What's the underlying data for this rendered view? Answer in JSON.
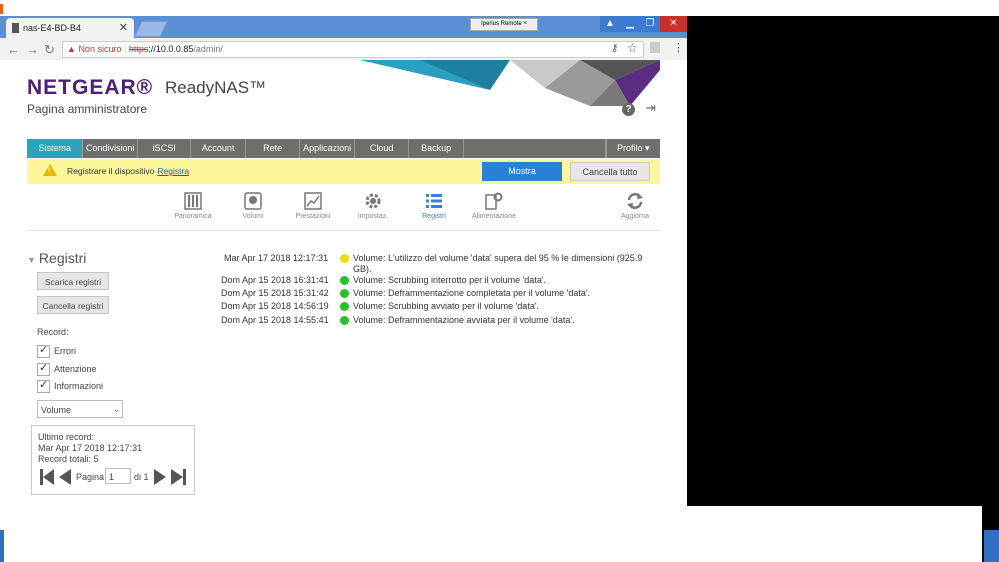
{
  "browser": {
    "tab_title": "nas-E4-BD-B4",
    "tab_close": "✕",
    "remote_label": "Iperius Remote",
    "url": {
      "warning": "▲",
      "not_secure": "Non sicuro",
      "scheme": "https",
      "host": "://10.0.0.85",
      "path": "/admin/"
    }
  },
  "header": {
    "logo": "NETGEAR®",
    "product": "ReadyNAS™",
    "subtitle": "Pagina amministratore"
  },
  "nav": {
    "tabs": [
      "Sistema",
      "Condivisioni",
      "iSCSI",
      "Account",
      "Rete",
      "Applicazioni",
      "Cloud",
      "Backup"
    ],
    "active_index": 0,
    "profile": "Profilo ▾"
  },
  "alert": {
    "message": "Registrare il dispositivo",
    "link": "Registra",
    "show_button": "Mostra",
    "cancel_button": "Cancella tutto"
  },
  "subnav": {
    "items": [
      "Panoramica",
      "Volumi",
      "Prestazioni",
      "Impostaz.",
      "Registri",
      "Alimentazione"
    ],
    "active": "Registri",
    "refresh": "Aggiorna"
  },
  "sidebar": {
    "title": "Registri",
    "download_button": "Scarica registri",
    "clear_button": "Cancella registri",
    "record_label": "Record:",
    "filters": [
      "Errori",
      "Attenzione",
      "Informazioni"
    ],
    "category_select": "Volume",
    "last_record_label": "Ultimo record:",
    "last_record_value": "Mar Apr 17 2018 12:17:31",
    "total_label": "Record totali: 5",
    "page_label": "Pagina",
    "page_value": "1",
    "page_of": "di 1"
  },
  "logs": [
    {
      "date": "Mar Apr 17 2018 12:17:31",
      "level": "warning",
      "text": "Volume: L'utilizzo del volume 'data' supera del 95 % le dimensioni (925.9 GB)."
    },
    {
      "date": "Dom Apr 15 2018 16:31:41",
      "level": "info",
      "text": "Volume: Scrubbing interrotto per il volume 'data'."
    },
    {
      "date": "Dom Apr 15 2018 15:31:42",
      "level": "info",
      "text": "Volume: Deframmentazione completata per il volume 'data'."
    },
    {
      "date": "Dom Apr 15 2018 14:56:19",
      "level": "info",
      "text": "Volume: Scrubbing avviato per il volume 'data'."
    },
    {
      "date": "Dom Apr 15 2018 14:55:41",
      "level": "info",
      "text": "Volume: Deframmentazione avviata per il volume 'data'."
    }
  ],
  "colors": {
    "accent": "#26a6b8",
    "brand": "#4b1f7a",
    "warning": "#e8e000",
    "info": "#22c322",
    "button_primary": "#2a7fd6"
  }
}
